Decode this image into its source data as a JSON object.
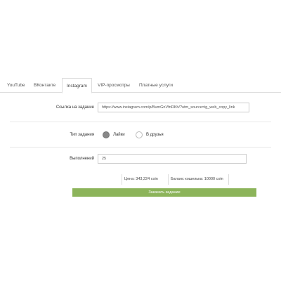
{
  "tabs": [
    {
      "label": "YouTube",
      "active": false
    },
    {
      "label": "ВКонтакте",
      "active": false
    },
    {
      "label": "Instagram",
      "active": true
    },
    {
      "label": "VIP-просмотры",
      "active": false
    },
    {
      "label": "Платные услуги",
      "active": false
    }
  ],
  "form": {
    "link_label": "Ссылка на задание",
    "link_value": "https://www.instagram.com/p/BumGnVfnRKh/?utm_source=ig_web_copy_link",
    "task_type_label": "Тип задания",
    "task_type_options": [
      {
        "label": "Лайки",
        "checked": true
      },
      {
        "label": "В друзья",
        "checked": false
      }
    ],
    "done_label": "Выполнений",
    "done_value": "25"
  },
  "stats": {
    "price": "Цена: 343,224 coin",
    "balance": "Баланс кошелька: 10000 coin"
  },
  "order_button_label": "Заказать задание",
  "colors": {
    "accent_green": "#8cb45a",
    "tab_border": "#dddddd"
  }
}
